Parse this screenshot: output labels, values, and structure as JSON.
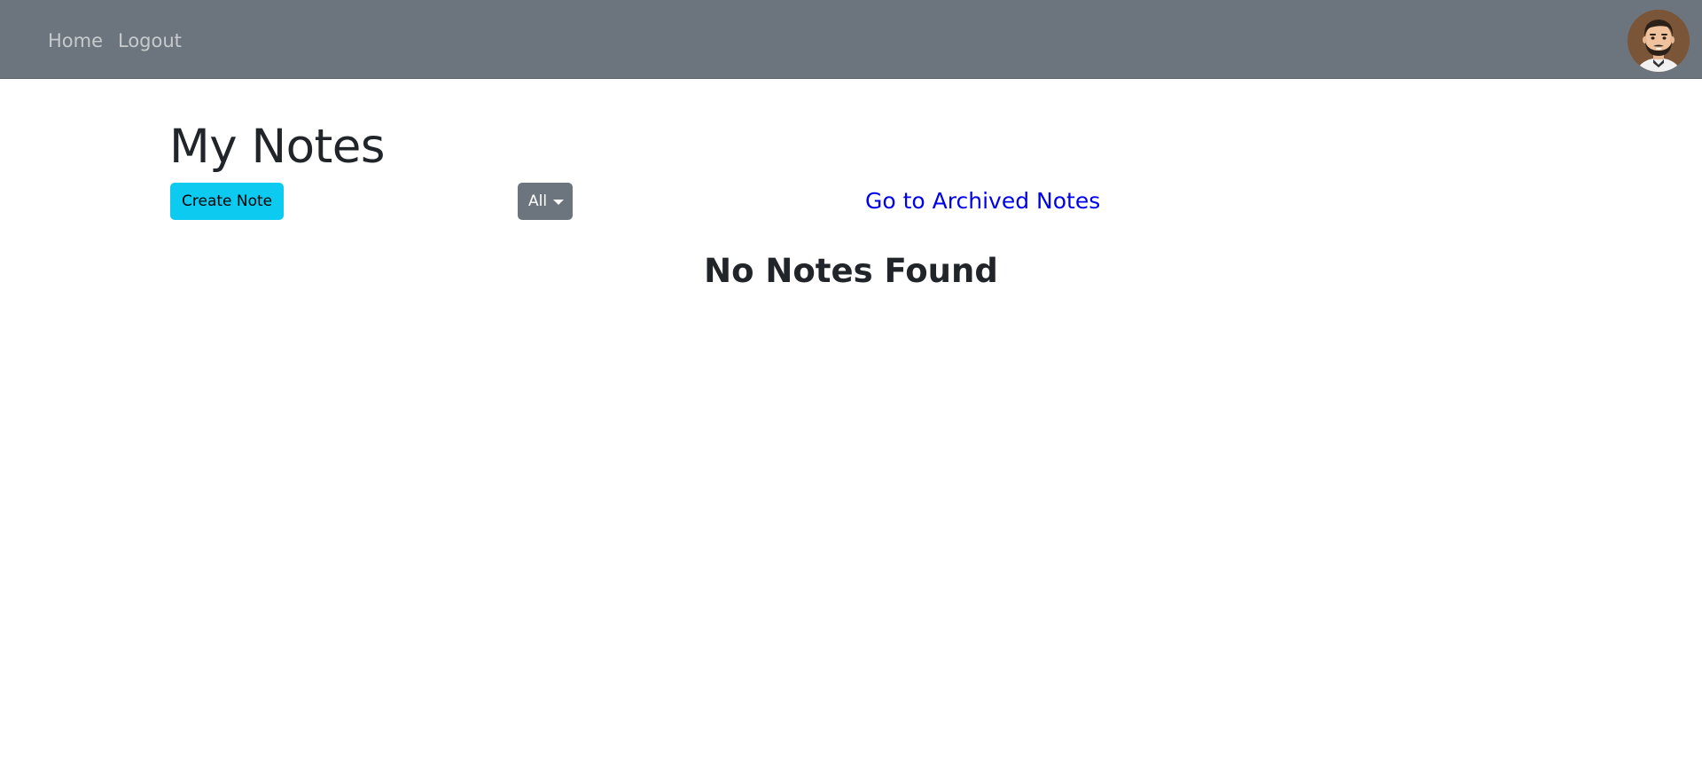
{
  "navbar": {
    "home_label": "Home",
    "logout_label": "Logout",
    "background_color": "#6c757d",
    "avatar_icon": "user-avatar-icon"
  },
  "main": {
    "title": "My Notes",
    "create_button_label": "Create Note",
    "filter_dropdown": {
      "selected": "All",
      "icon": "caret-down-icon"
    },
    "archive_link_label": "Go to Archived Notes",
    "empty_message": "No Notes Found"
  },
  "colors": {
    "create_button": "#0dcaf0",
    "filter_button": "#6c757d",
    "link": "#0000ee",
    "text": "#212529"
  }
}
